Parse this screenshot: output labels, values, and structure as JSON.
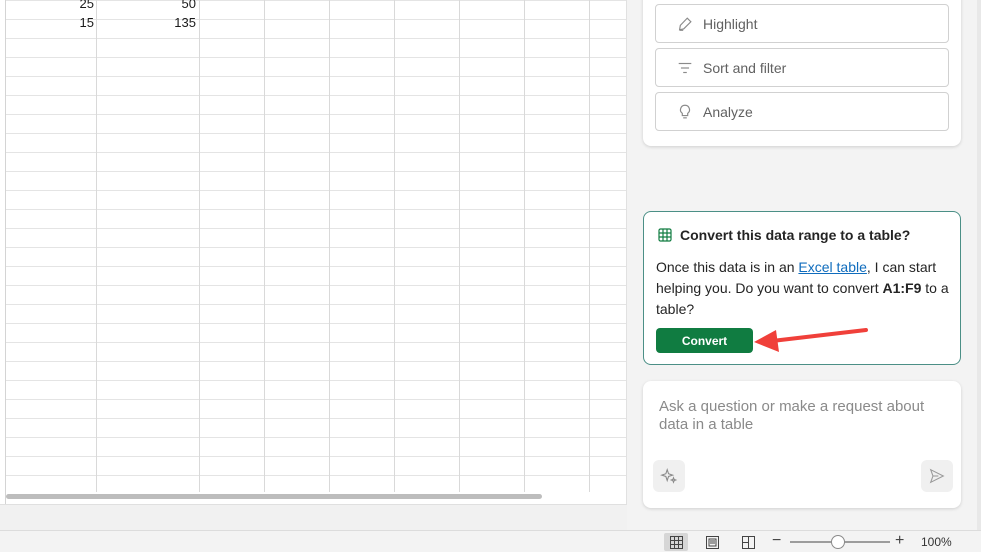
{
  "sheet": {
    "rows": [
      {
        "b": "25",
        "c": "50"
      },
      {
        "b": "15",
        "c": "135"
      }
    ]
  },
  "quick_actions": [
    {
      "label": "Highlight",
      "icon": "highlighter-icon"
    },
    {
      "label": "Sort and filter",
      "icon": "filter-icon"
    },
    {
      "label": "Analyze",
      "icon": "lightbulb-icon"
    }
  ],
  "convert_card": {
    "title": "Convert this data range to a table?",
    "body_prefix": "Once this data is in an ",
    "link_text": "Excel table",
    "body_middle": ", I can start helping you. Do you want to convert ",
    "range": "A1:F9",
    "body_suffix": " to a table?",
    "button_label": "Convert"
  },
  "ask": {
    "placeholder": "Ask a question or make a request about data in a table"
  },
  "status_bar": {
    "zoom_label": "100%",
    "zoom_minus": "−",
    "zoom_plus": "+"
  },
  "colors": {
    "accent_green": "#107c41",
    "card_border": "#4b8f86",
    "link_blue": "#0f6cbd",
    "arrow_red": "#f0403a"
  }
}
